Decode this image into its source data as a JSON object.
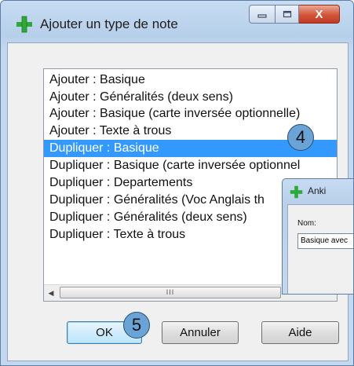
{
  "window": {
    "title": "Ajouter un type de note",
    "controls": {
      "minimize": "—",
      "maximize": "▢",
      "close": "X"
    }
  },
  "note_types": [
    {
      "label": "Ajouter : Basique",
      "selected": false
    },
    {
      "label": "Ajouter : Généralités (deux sens)",
      "selected": false
    },
    {
      "label": "Ajouter : Basique (carte inversée optionnelle)",
      "selected": false
    },
    {
      "label": "Ajouter : Texte à trous",
      "selected": false
    },
    {
      "label": "Dupliquer : Basique",
      "selected": true
    },
    {
      "label": "Dupliquer : Basique (carte inversée optionnel",
      "selected": false
    },
    {
      "label": "Dupliquer : Departements",
      "selected": false
    },
    {
      "label": "Dupliquer : Généralités (Voc Anglais th",
      "selected": false
    },
    {
      "label": "Dupliquer : Généralités (deux sens)",
      "selected": false
    },
    {
      "label": "Dupliquer : Texte à trous",
      "selected": false
    }
  ],
  "scrollbar": {
    "left_arrow": "◀",
    "right_arrow": "▶",
    "grip": "III"
  },
  "badges": {
    "step4": "4",
    "step5": "5"
  },
  "anki_dialog": {
    "title": "Anki",
    "name_label": "Nom:",
    "name_value": "Basique avec"
  },
  "buttons": {
    "ok": "OK",
    "cancel": "Annuler",
    "help": "Aide"
  },
  "colors": {
    "selection": "#3399ff",
    "badge": "#6aa4d6",
    "plus_icon": "#2ea836"
  }
}
